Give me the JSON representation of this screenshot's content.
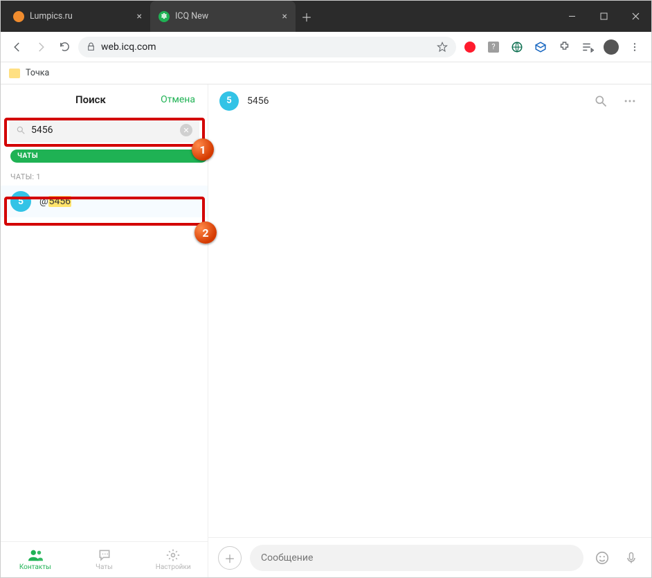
{
  "browser": {
    "tabs": [
      {
        "title": "Lumpics.ru",
        "favicon_color": "#f08c2e"
      },
      {
        "title": "ICQ New",
        "favicon_color": "#1fb254"
      }
    ],
    "url_display": "web.icq.com",
    "bookmark": "Точка"
  },
  "sidebar": {
    "title": "Поиск",
    "cancel": "Отмена",
    "search_value": "5456",
    "chip": "ЧАТЫ",
    "section_label": "ЧАТЫ: 1",
    "result_prefix": "@",
    "result_match": "5456",
    "avatar_char": "5",
    "footer": {
      "contacts": "Контакты",
      "chats": "Чаты",
      "settings": "Настройки"
    }
  },
  "chat": {
    "peer_avatar_char": "5",
    "peer_name": "5456",
    "composer_placeholder": "Сообщение"
  },
  "annotations": {
    "one": "1",
    "two": "2"
  }
}
